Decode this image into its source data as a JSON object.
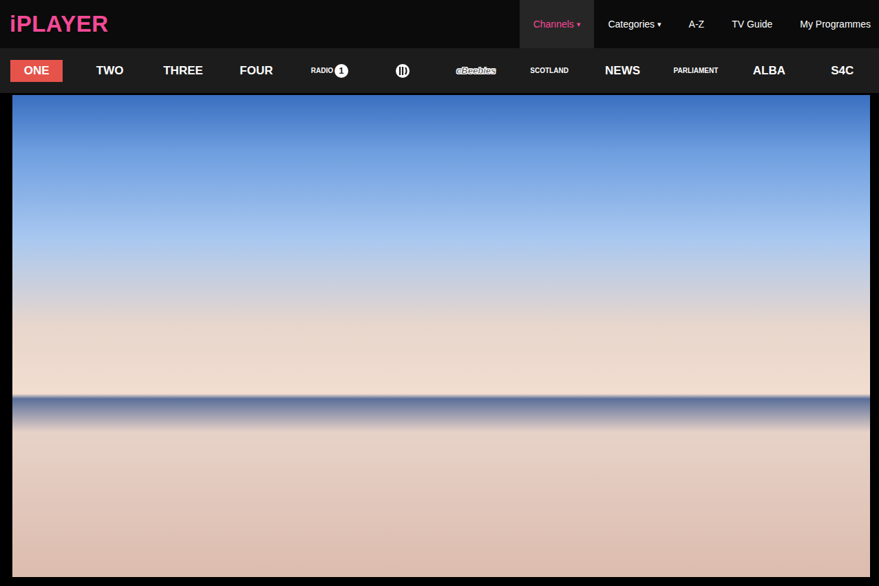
{
  "logo": "iPLAYER",
  "dropdown_mark": "▾",
  "nav": [
    {
      "label": "Channels",
      "dropdown": true,
      "selected": true
    },
    {
      "label": "Categories",
      "dropdown": true,
      "selected": false
    },
    {
      "label": "A-Z",
      "dropdown": false,
      "selected": false
    },
    {
      "label": "TV Guide",
      "dropdown": false,
      "selected": false
    },
    {
      "label": "My Programmes",
      "dropdown": false,
      "selected": false
    }
  ],
  "channels": [
    {
      "label": "ONE",
      "kind": "text",
      "selected": true
    },
    {
      "label": "TWO",
      "kind": "text",
      "selected": false
    },
    {
      "label": "THREE",
      "kind": "text",
      "selected": false
    },
    {
      "label": "FOUR",
      "kind": "text",
      "selected": false
    },
    {
      "label": "RADIO",
      "badge": "1",
      "kind": "radio",
      "selected": false
    },
    {
      "label": "",
      "kind": "cbbc",
      "selected": false
    },
    {
      "label": "cBeebies",
      "kind": "cbeebies",
      "selected": false
    },
    {
      "label": "SCOTLAND",
      "kind": "small",
      "selected": false
    },
    {
      "label": "NEWS",
      "kind": "text",
      "selected": false
    },
    {
      "label": "PARLIAMENT",
      "kind": "small",
      "selected": false
    },
    {
      "label": "ALBA",
      "kind": "text",
      "selected": false
    },
    {
      "label": "S4C",
      "kind": "text",
      "selected": false
    }
  ]
}
